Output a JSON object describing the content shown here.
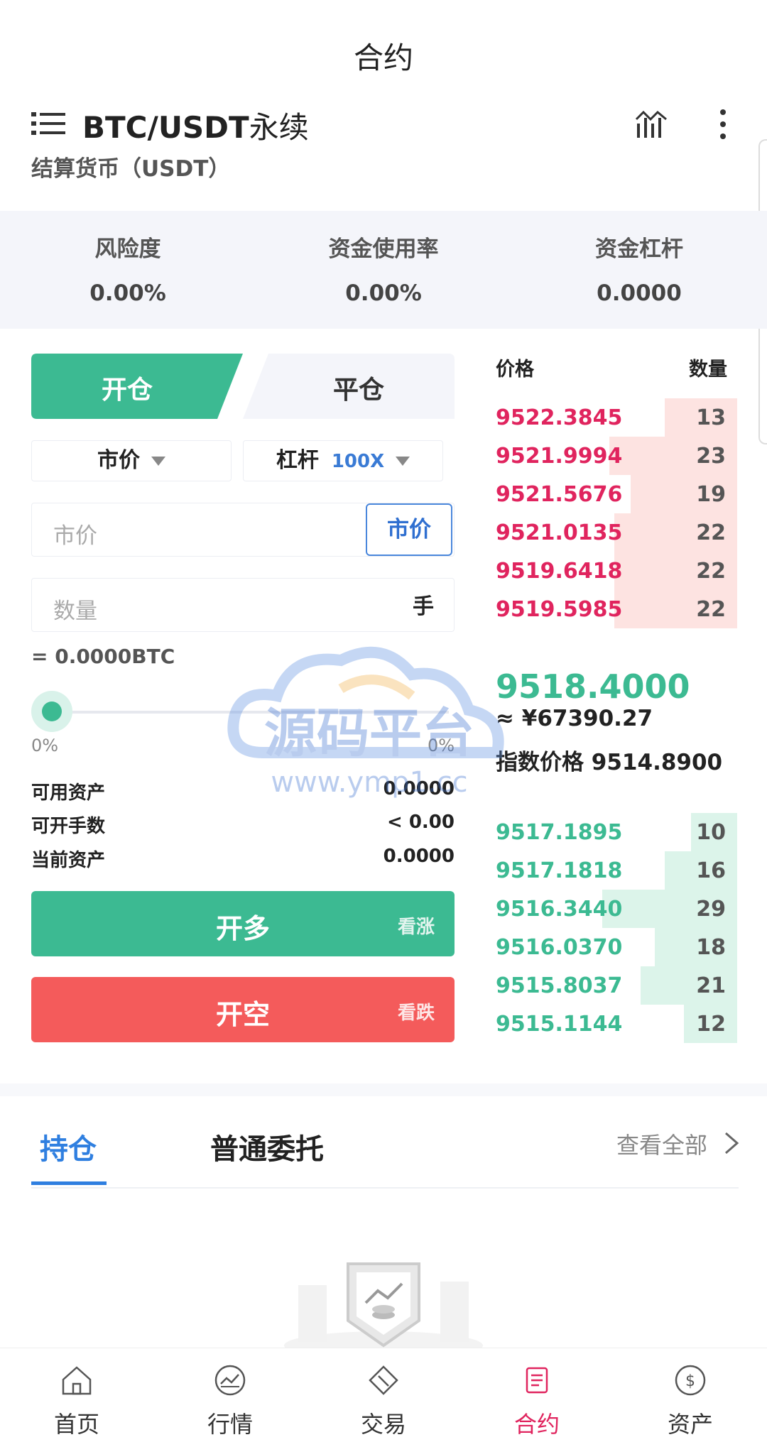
{
  "header": {
    "title": "合约"
  },
  "pair": {
    "name": "BTC/USDT",
    "suffix": "永续",
    "settle": "结算货币（USDT）"
  },
  "risk": [
    {
      "label": "风险度",
      "value": "0.00%"
    },
    {
      "label": "资金使用率",
      "value": "0.00%"
    },
    {
      "label": "资金杠杆",
      "value": "0.0000"
    }
  ],
  "tabs": {
    "open": "开仓",
    "close": "平仓"
  },
  "order_type": {
    "label": "市价"
  },
  "leverage": {
    "label": "杠杆",
    "value": "100X"
  },
  "price_input": {
    "placeholder": "市价",
    "button": "市价"
  },
  "qty_input": {
    "placeholder": "数量",
    "unit": "手"
  },
  "btc_equiv": "= 0.0000BTC",
  "slider": {
    "min_label": "0%",
    "max_label": "0%",
    "value_fraction": 0
  },
  "info": [
    {
      "key": "可用资产",
      "value": "0.0000"
    },
    {
      "key": "可开手数",
      "value": "< 0.00"
    },
    {
      "key": "当前资产",
      "value": "0.0000"
    }
  ],
  "actions": {
    "long": {
      "label": "开多",
      "hint": "看涨"
    },
    "short": {
      "label": "开空",
      "hint": "看跌"
    }
  },
  "orderbook": {
    "header_price": "价格",
    "header_qty": "数量",
    "asks": [
      {
        "price": "9522.3845",
        "qty": "13",
        "depth": 0.3
      },
      {
        "price": "9521.9994",
        "qty": "23",
        "depth": 0.53
      },
      {
        "price": "9521.5676",
        "qty": "19",
        "depth": 0.44
      },
      {
        "price": "9521.0135",
        "qty": "22",
        "depth": 0.51
      },
      {
        "price": "9519.6418",
        "qty": "22",
        "depth": 0.51
      },
      {
        "price": "9519.5985",
        "qty": "22",
        "depth": 0.51
      }
    ],
    "last_price": "9518.4000",
    "cny_price": "≈ ¥67390.27",
    "index_label": "指数价格",
    "index_value": "9514.8900",
    "bids": [
      {
        "price": "9517.1895",
        "qty": "10",
        "depth": 0.19
      },
      {
        "price": "9517.1818",
        "qty": "16",
        "depth": 0.3
      },
      {
        "price": "9516.3440",
        "qty": "29",
        "depth": 0.56
      },
      {
        "price": "9516.0370",
        "qty": "18",
        "depth": 0.34
      },
      {
        "price": "9515.8037",
        "qty": "21",
        "depth": 0.4
      },
      {
        "price": "9515.1144",
        "qty": "12",
        "depth": 0.22
      }
    ]
  },
  "positions": {
    "tab_hold": "持仓",
    "tab_entrust": "普通委托",
    "view_all": "查看全部"
  },
  "nav": [
    {
      "label": "首页"
    },
    {
      "label": "行情"
    },
    {
      "label": "交易"
    },
    {
      "label": "合约"
    },
    {
      "label": "资产"
    }
  ],
  "watermark": {
    "title": "源码平台",
    "url": "www.ymp1.cc"
  },
  "colors": {
    "green": "#3cba92",
    "red": "#f45b5b",
    "ask_text": "#e0245e",
    "blue": "#2f7fe0"
  }
}
